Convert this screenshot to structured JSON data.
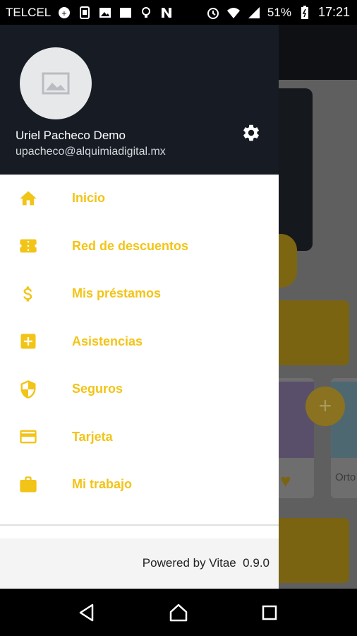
{
  "status_bar": {
    "carrier": "TELCEL",
    "battery": "51%",
    "time": "17:21",
    "icons": [
      "data-icon",
      "sim-icon",
      "image-icon",
      "clapper-icon",
      "bulb-icon",
      "n-icon",
      "alarm-icon",
      "wifi-icon",
      "signal-icon",
      "battery-icon"
    ]
  },
  "drawer": {
    "user_name": "Uriel Pacheco Demo",
    "user_email": "upacheco@alquimiadigital.mx",
    "menu": [
      {
        "label": "Inicio",
        "icon": "home-icon"
      },
      {
        "label": "Red de descuentos",
        "icon": "ticket-icon"
      },
      {
        "label": "Mis préstamos",
        "icon": "dollar-icon"
      },
      {
        "label": "Asistencias",
        "icon": "plus-box-icon"
      },
      {
        "label": "Seguros",
        "icon": "shield-icon"
      },
      {
        "label": "Tarjeta",
        "icon": "card-icon"
      },
      {
        "label": "Mi trabajo",
        "icon": "briefcase-icon"
      }
    ],
    "footer": "Powered by Vitae  0.9.0"
  },
  "background": {
    "tile_text": "Orto"
  },
  "colors": {
    "accent": "#f2c417",
    "header_bg": "#161b24"
  }
}
